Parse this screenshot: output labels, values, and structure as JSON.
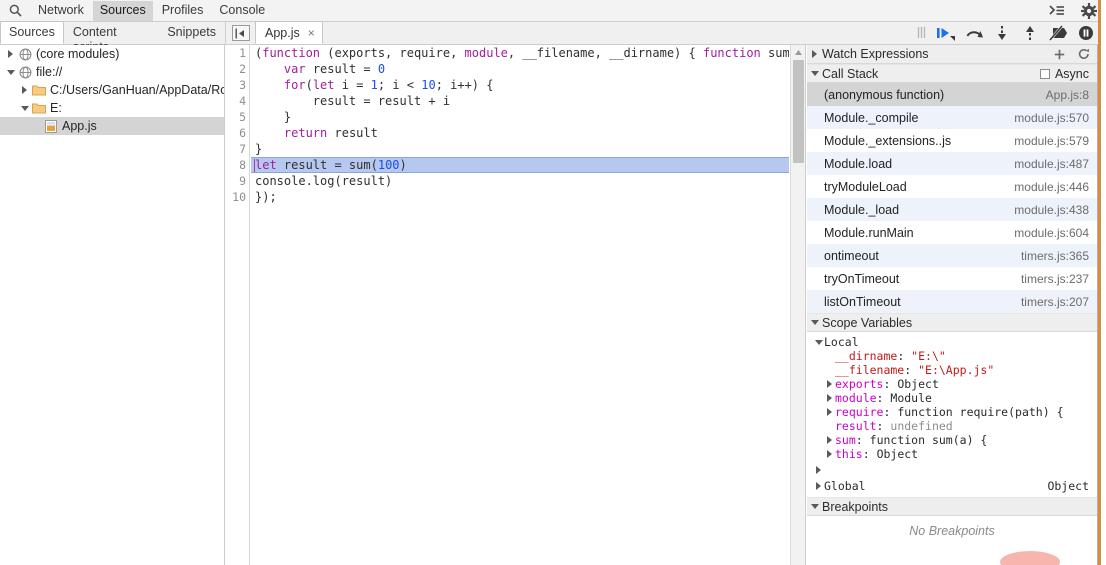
{
  "topbar": {
    "search_icon": "search-icon",
    "menu": [
      {
        "label": "Network",
        "active": false
      },
      {
        "label": "Sources",
        "active": true
      },
      {
        "label": "Profiles",
        "active": false
      },
      {
        "label": "Console",
        "active": false
      }
    ],
    "right_icons": [
      {
        "name": "console-drawer-icon",
        "glyph": "≻≡"
      },
      {
        "name": "settings-gear-icon",
        "glyph": "⚙"
      }
    ]
  },
  "secondbar": {
    "subtabs": [
      {
        "label": "Sources",
        "selected": true
      },
      {
        "label": "Content scripts",
        "selected": false
      },
      {
        "label": "Snippets",
        "selected": false
      }
    ],
    "nav_toggle_name": "toggle-navigator-icon",
    "file_tab": {
      "label": "App.js",
      "close": "×"
    },
    "debugger_controls": [
      {
        "name": "resume-script-execution-button",
        "title": "Resume"
      },
      {
        "name": "step-over-button",
        "title": "Step over next function call"
      },
      {
        "name": "step-into-button",
        "title": "Step into next function call"
      },
      {
        "name": "step-out-button",
        "title": "Step out of current function"
      },
      {
        "name": "deactivate-breakpoints-button",
        "title": "Deactivate breakpoints"
      },
      {
        "name": "pause-on-exceptions-button",
        "title": "Pause on exceptions"
      }
    ]
  },
  "navigator": {
    "items": [
      {
        "label": "(core modules)",
        "icon": "globe-icon",
        "twisty": "right",
        "indent": 0,
        "selected": false
      },
      {
        "label": "file://",
        "icon": "globe-icon",
        "twisty": "down",
        "indent": 0,
        "selected": false
      },
      {
        "label": "C:/Users/GanHuan/AppData/Roar",
        "icon": "folder-icon",
        "twisty": "right",
        "indent": 1,
        "selected": false
      },
      {
        "label": "E:",
        "icon": "folder-icon",
        "twisty": "down",
        "indent": 1,
        "selected": false
      },
      {
        "label": "App.js",
        "icon": "js-file-icon",
        "twisty": "none",
        "indent": 2,
        "selected": true
      }
    ]
  },
  "editor": {
    "line_numbers": [
      "1",
      "2",
      "3",
      "4",
      "5",
      "6",
      "7",
      "8",
      "9",
      "10"
    ],
    "lines": [
      {
        "n": 1,
        "text": "(function (exports, require, module, __filename, __dirname) { function sum(a) {",
        "highlight": false
      },
      {
        "n": 2,
        "text": "    var result = 0",
        "highlight": false
      },
      {
        "n": 3,
        "text": "    for(let i = 1; i < 10; i++) {",
        "highlight": false
      },
      {
        "n": 4,
        "text": "        result = result + i",
        "highlight": false
      },
      {
        "n": 5,
        "text": "    }",
        "highlight": false
      },
      {
        "n": 6,
        "text": "    return result",
        "highlight": false
      },
      {
        "n": 7,
        "text": "}",
        "highlight": false
      },
      {
        "n": 8,
        "text": "let result = sum(100)",
        "highlight": true
      },
      {
        "n": 9,
        "text": "console.log(result)",
        "highlight": false
      },
      {
        "n": 10,
        "text": "});",
        "highlight": false
      }
    ],
    "selected_line": 8,
    "colors": {
      "keyword": "#a020a0",
      "number": "#1750eb",
      "selection": "#b6c8f0"
    }
  },
  "sidebar": {
    "watch": {
      "title": "Watch Expressions",
      "add_icon": "plus-icon",
      "refresh_icon": "refresh-icon",
      "collapsed": true
    },
    "callstack": {
      "title": "Call Stack",
      "async_label": "Async",
      "async_checked": false,
      "frames": [
        {
          "name": "(anonymous function)",
          "location": "App.js:8",
          "selected": true
        },
        {
          "name": "Module._compile",
          "location": "module.js:570",
          "selected": false
        },
        {
          "name": "Module._extensions..js",
          "location": "module.js:579",
          "selected": false
        },
        {
          "name": "Module.load",
          "location": "module.js:487",
          "selected": false
        },
        {
          "name": "tryModuleLoad",
          "location": "module.js:446",
          "selected": false
        },
        {
          "name": "Module._load",
          "location": "module.js:438",
          "selected": false
        },
        {
          "name": "Module.runMain",
          "location": "module.js:604",
          "selected": false
        },
        {
          "name": "ontimeout",
          "location": "timers.js:365",
          "selected": false
        },
        {
          "name": "tryOnTimeout",
          "location": "timers.js:237",
          "selected": false
        },
        {
          "name": "listOnTimeout",
          "location": "timers.js:207",
          "selected": false
        }
      ]
    },
    "scope": {
      "title": "Scope Variables",
      "local_label": "Local",
      "vars": [
        {
          "twisty": "none",
          "name": "__dirname",
          "sep": ": ",
          "value": "\"E:\\\"",
          "kind": "string",
          "namekind": "red"
        },
        {
          "twisty": "none",
          "name": "__filename",
          "sep": ": ",
          "value": "\"E:\\App.js\"",
          "kind": "string",
          "namekind": "red"
        },
        {
          "twisty": "right",
          "name": "exports",
          "sep": ": ",
          "value": "Object",
          "kind": "plain",
          "namekind": "magenta"
        },
        {
          "twisty": "right",
          "name": "module",
          "sep": ": ",
          "value": "Module",
          "kind": "plain",
          "namekind": "magenta"
        },
        {
          "twisty": "right",
          "name": "require",
          "sep": ": ",
          "value": "function require(path) {",
          "kind": "plain",
          "namekind": "magenta"
        },
        {
          "twisty": "none",
          "name": "result",
          "sep": ": ",
          "value": "undefined",
          "kind": "undef",
          "namekind": "magenta"
        },
        {
          "twisty": "right",
          "name": "sum",
          "sep": ": ",
          "value": "function sum(a) {",
          "kind": "plain",
          "namekind": "magenta"
        },
        {
          "twisty": "right",
          "name": "this",
          "sep": ": ",
          "value": "Object",
          "kind": "plain",
          "namekind": "magenta"
        }
      ],
      "closure_row": "",
      "global_label": "Global",
      "global_value": "Object"
    },
    "breakpoints": {
      "title": "Breakpoints",
      "empty_text": "No Breakpoints"
    }
  }
}
